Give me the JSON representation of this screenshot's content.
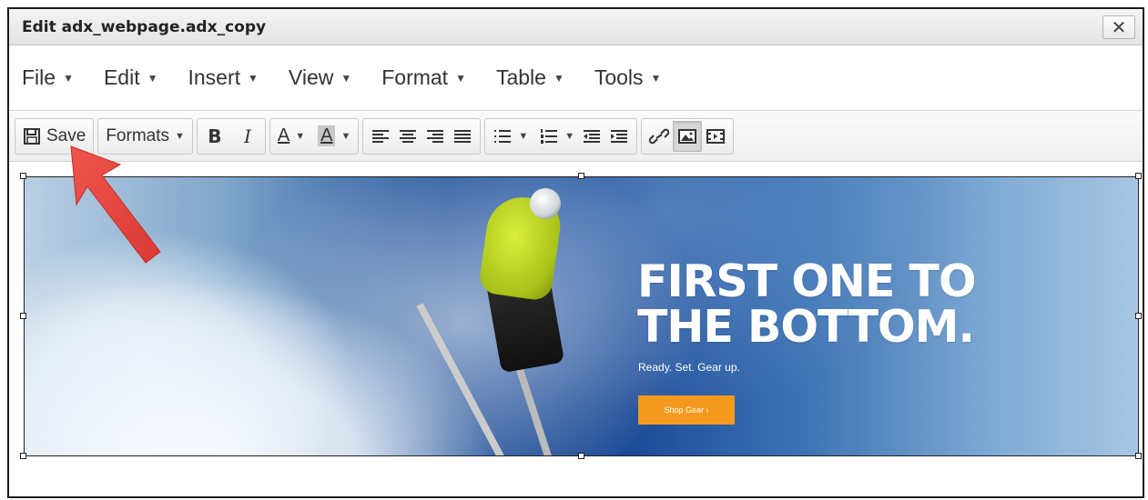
{
  "window": {
    "title": "Edit adx_webpage.adx_copy",
    "close_glyph": "✕"
  },
  "menubar": {
    "items": [
      {
        "label": "File"
      },
      {
        "label": "Edit"
      },
      {
        "label": "Insert"
      },
      {
        "label": "View"
      },
      {
        "label": "Format"
      },
      {
        "label": "Table"
      },
      {
        "label": "Tools"
      }
    ],
    "caret": "▼"
  },
  "toolbar": {
    "save_label": "Save",
    "formats_label": "Formats",
    "bold_label": "B",
    "italic_label": "I",
    "text_color_label": "A",
    "bg_color_label": "A"
  },
  "banner": {
    "headline_line1": "FIRST ONE TO",
    "headline_line2": "THE BOTTOM.",
    "subline": "Ready. Set. Gear up.",
    "button_label": "Shop Gear  ›"
  },
  "colors": {
    "accent_orange": "#f39a1e",
    "arrow_red": "#e8403a",
    "jacket": "#c8e21f"
  }
}
